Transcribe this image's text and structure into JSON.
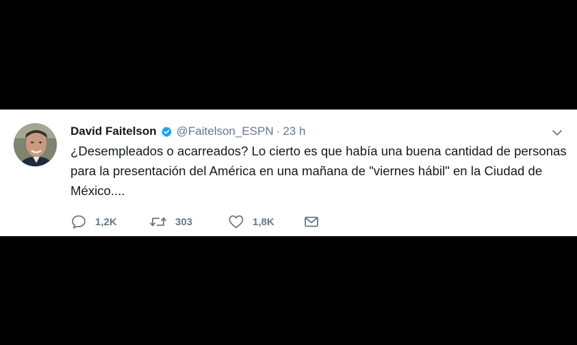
{
  "tweet": {
    "author_name": "David Faitelson",
    "handle": "@Faitelson_ESPN",
    "separator": "·",
    "time": "23 h",
    "text": "¿Desempleados o acarreados? Lo cierto es que había una buena cantidad de personas para la presentación del América en una mañana de \"viernes hábil\" en la Ciudad de México....",
    "verified": true
  },
  "actions": {
    "replies": "1,2K",
    "retweets": "303",
    "likes": "1,8K"
  },
  "icons": {
    "verified": "verified-badge-icon",
    "caret": "chevron-down-icon",
    "reply": "reply-bubble-icon",
    "retweet": "retweet-icon",
    "like": "heart-icon",
    "dm": "envelope-icon"
  },
  "colors": {
    "verified_blue": "#1da1f2",
    "secondary_text": "#657786",
    "primary_text": "#14171a",
    "background": "#ffffff",
    "letterbox": "#000000"
  }
}
